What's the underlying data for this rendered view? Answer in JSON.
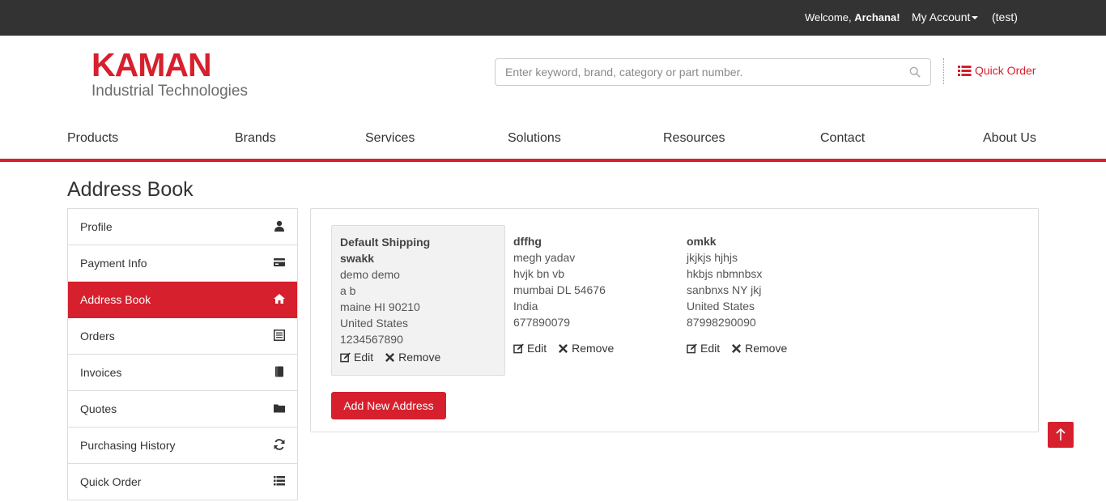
{
  "topbar": {
    "welcome_prefix": "Welcome,",
    "user_name": "Archana!",
    "account_label": "My Account",
    "test_label": "(test)"
  },
  "header": {
    "logo_brand": "KAMAN",
    "logo_sub": "Industrial Technologies",
    "search_placeholder": "Enter keyword, brand, category or part number.",
    "quick_order_label": "Quick Order"
  },
  "nav": {
    "items": [
      "Products",
      "Brands",
      "Services",
      "Solutions",
      "Resources",
      "Contact",
      "About Us"
    ]
  },
  "page": {
    "title": "Address Book"
  },
  "sidebar": {
    "items": [
      {
        "label": "Profile",
        "icon": "user-icon"
      },
      {
        "label": "Payment Info",
        "icon": "credit-card-icon"
      },
      {
        "label": "Address Book",
        "icon": "home-icon",
        "active": true
      },
      {
        "label": "Orders",
        "icon": "list-alt-icon"
      },
      {
        "label": "Invoices",
        "icon": "book-icon"
      },
      {
        "label": "Quotes",
        "icon": "folder-icon"
      },
      {
        "label": "Purchasing History",
        "icon": "refresh-icon"
      },
      {
        "label": "Quick Order",
        "icon": "list-icon"
      }
    ]
  },
  "addresses": [
    {
      "heading": "Default Shipping",
      "name": "swakk",
      "lines": [
        "demo demo",
        "a b",
        "maine  HI  90210",
        "United States",
        "1234567890"
      ]
    },
    {
      "name": "dffhg",
      "lines": [
        "megh yadav",
        "hvjk bn vb",
        "mumbai  DL  54676",
        "India",
        "677890079"
      ]
    },
    {
      "name": "omkk",
      "lines": [
        "jkjkjs hjhjs",
        "hkbjs nbmnbsx",
        "sanbnxs  NY  jkj",
        "United States",
        "87998290090"
      ]
    }
  ],
  "actions": {
    "edit_label": "Edit",
    "remove_label": "Remove"
  },
  "add_new_address_label": "Add New Address",
  "colors": {
    "accent": "#d7202d",
    "topbar": "#333333"
  }
}
